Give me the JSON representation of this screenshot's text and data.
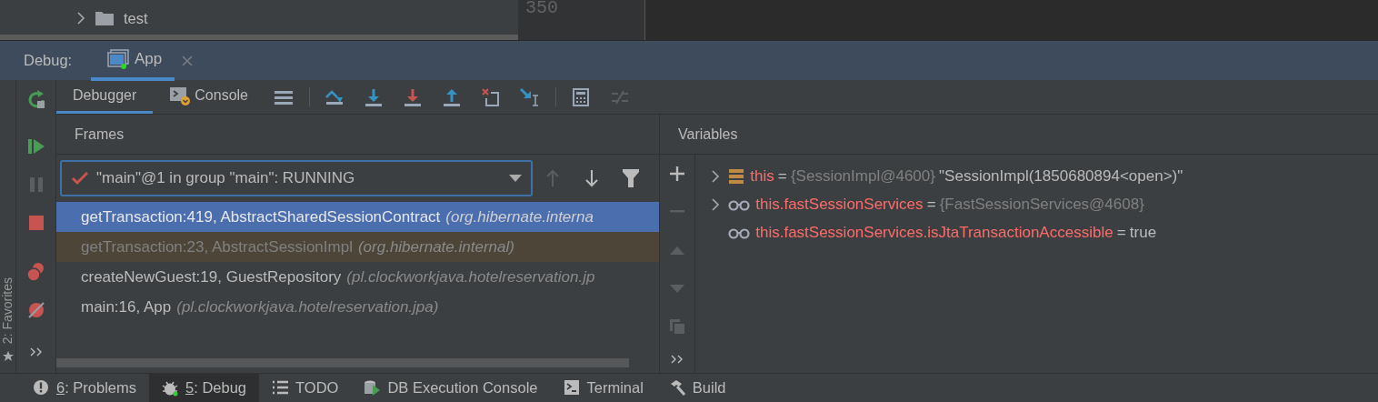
{
  "editor": {
    "tree_item": "test",
    "line_number": "350"
  },
  "debug": {
    "label": "Debug:",
    "tabs": [
      {
        "label": "App",
        "selected": true
      }
    ]
  },
  "sidebar": {
    "label": "2: Favorites"
  },
  "toolbar": {
    "tabs": [
      {
        "label": "Debugger",
        "kind": "debugger",
        "selected": true
      },
      {
        "label": "Console",
        "kind": "console",
        "selected": false
      }
    ]
  },
  "frames": {
    "title": "Frames",
    "thread": "\"main\"@1 in group \"main\": RUNNING",
    "rows": [
      {
        "method": "getTransaction:419, AbstractSharedSessionContract",
        "package": "(org.hibernate.interna",
        "selected": true,
        "library": false
      },
      {
        "method": "getTransaction:23, AbstractSessionImpl",
        "package": "(org.hibernate.internal)",
        "selected": false,
        "library": true
      },
      {
        "method": "createNewGuest:19, GuestRepository",
        "package": "(pl.clockworkjava.hotelreservation.jp",
        "selected": false,
        "library": false
      },
      {
        "method": "main:16, App",
        "package": "(pl.clockworkjava.hotelreservation.jpa)",
        "selected": false,
        "library": false
      }
    ]
  },
  "variables": {
    "title": "Variables",
    "items": [
      {
        "kind": "field",
        "expandable": true,
        "name": "this",
        "operator": "=",
        "type_ref": "{SessionImpl@4600}",
        "value": "\"SessionImpl(1850680894<open>)\""
      },
      {
        "kind": "watch",
        "expandable": true,
        "name": "this.fastSessionServices",
        "operator": "=",
        "type_ref": "{FastSessionServices@4608}"
      },
      {
        "kind": "watch",
        "expandable": false,
        "name": "this.fastSessionServices.isJtaTransactionAccessible",
        "operator": "=",
        "value": "true"
      }
    ]
  },
  "tool_windows": [
    {
      "kind": "problems",
      "mnemonic": "6",
      "label": ": Problems",
      "selected": false
    },
    {
      "kind": "debug",
      "mnemonic": "5",
      "label": ": Debug",
      "selected": true
    },
    {
      "kind": "todo",
      "label": "TODO",
      "selected": false
    },
    {
      "kind": "db",
      "label": "DB Execution Console",
      "selected": false
    },
    {
      "kind": "terminal",
      "label": "Terminal",
      "selected": false
    },
    {
      "kind": "build",
      "label": "Build",
      "selected": false
    }
  ]
}
